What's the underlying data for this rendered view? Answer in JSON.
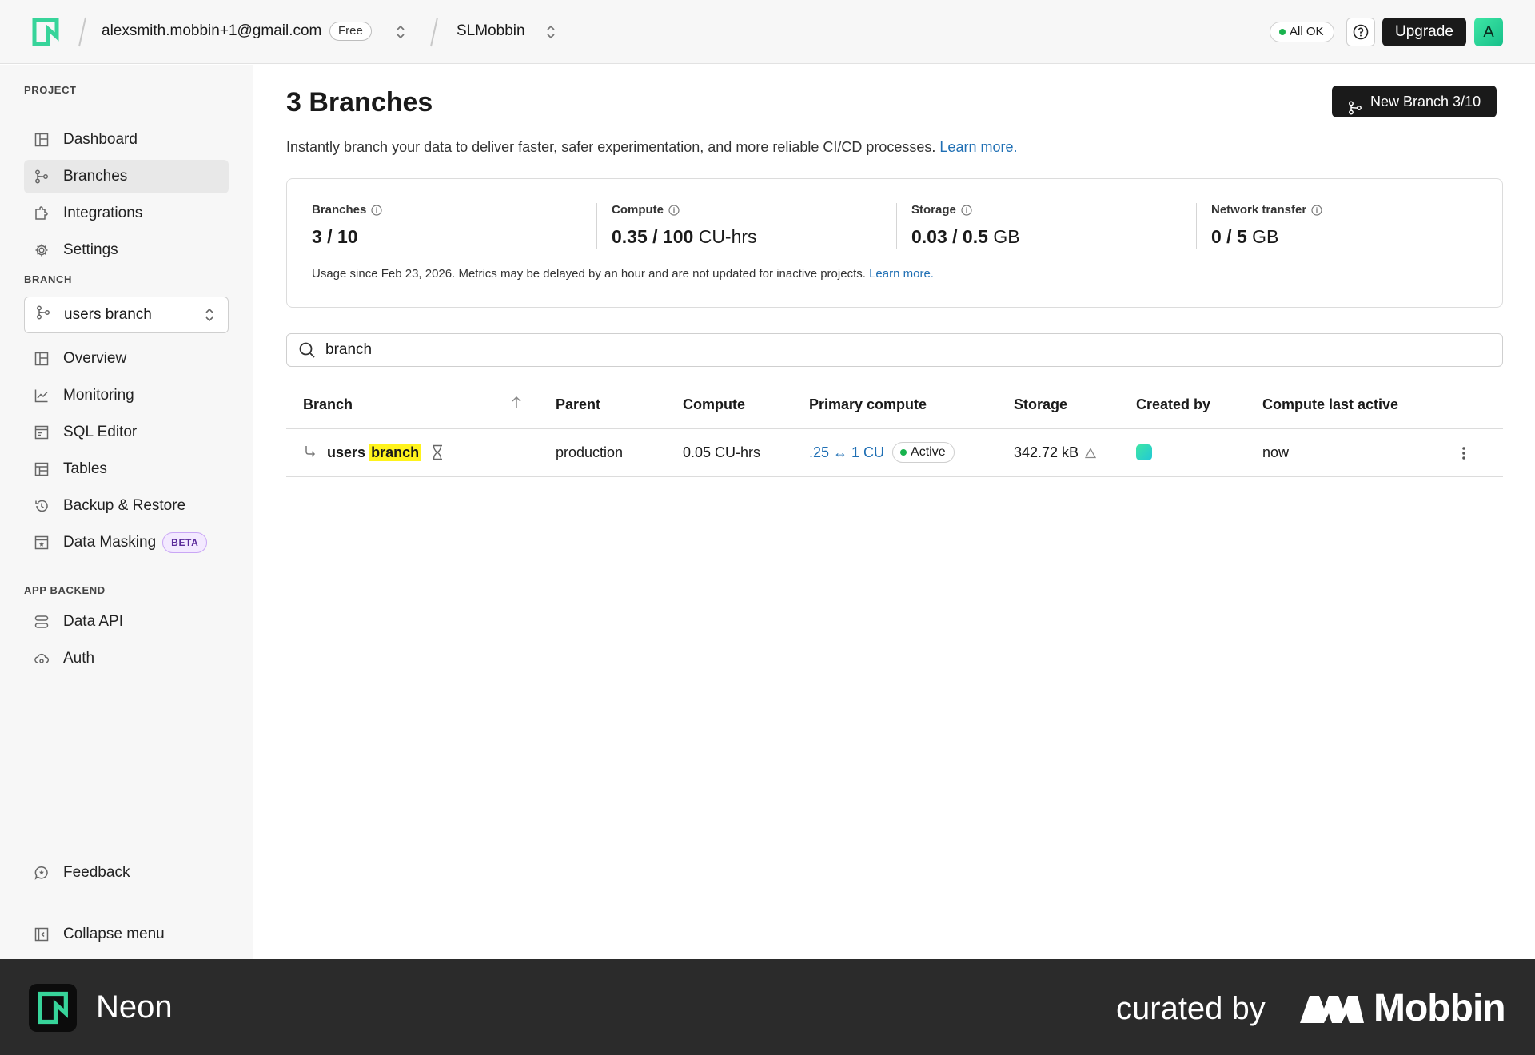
{
  "topbar": {
    "account_email": "alexsmith.mobbin+1@gmail.com",
    "plan_badge": "Free",
    "project_name": "SLMobbin",
    "status_label": "All OK",
    "upgrade_label": "Upgrade",
    "avatar_initial": "A"
  },
  "sidebar": {
    "project_label": "PROJECT",
    "project_items": [
      {
        "label": "Dashboard",
        "icon": "dashboard-icon"
      },
      {
        "label": "Branches",
        "icon": "branch-icon"
      },
      {
        "label": "Integrations",
        "icon": "puzzle-icon"
      },
      {
        "label": "Settings",
        "icon": "gear-icon"
      }
    ],
    "branch_label": "BRANCH",
    "branch_selector": "users branch",
    "branch_items": [
      {
        "label": "Overview",
        "icon": "overview-icon"
      },
      {
        "label": "Monitoring",
        "icon": "chart-line-icon"
      },
      {
        "label": "SQL Editor",
        "icon": "sql-editor-icon"
      },
      {
        "label": "Tables",
        "icon": "table-icon"
      },
      {
        "label": "Backup & Restore",
        "icon": "history-icon"
      },
      {
        "label": "Data Masking",
        "icon": "mask-icon",
        "badge": "BETA"
      }
    ],
    "backend_label": "APP BACKEND",
    "backend_items": [
      {
        "label": "Data API",
        "icon": "api-icon"
      },
      {
        "label": "Auth",
        "icon": "auth-cloud-icon"
      }
    ],
    "feedback_label": "Feedback",
    "collapse_label": "Collapse menu"
  },
  "main": {
    "title": "3 Branches",
    "new_branch_label": "New Branch 3/10",
    "subtitle": "Instantly branch your data to deliver faster, safer experimentation, and more reliable CI/CD processes.",
    "subtitle_link": "Learn more.",
    "usage": {
      "metrics": [
        {
          "label": "Branches",
          "value": "3 / 10",
          "unit": ""
        },
        {
          "label": "Compute",
          "value": "0.35 / 100",
          "unit": "CU-hrs"
        },
        {
          "label": "Storage",
          "value": "0.03 / 0.5",
          "unit": "GB"
        },
        {
          "label": "Network transfer",
          "value": "0 / 5",
          "unit": "GB"
        }
      ],
      "note": "Usage since Feb 23, 2026. Metrics may be delayed by an hour and are not updated for inactive projects.",
      "note_link": "Learn more."
    },
    "search_value": "branch",
    "table": {
      "columns": [
        "Branch",
        "Parent",
        "Compute",
        "Primary compute",
        "Storage",
        "Created by",
        "Compute last active"
      ],
      "rows": [
        {
          "branch_prefix": "users",
          "branch_match": "branch",
          "parent": "production",
          "compute": "0.05 CU-hrs",
          "primary_compute_range": ".25 ↔ 1 CU",
          "primary_compute_status": "Active",
          "storage": "342.72 kB",
          "last_active": "now"
        }
      ]
    }
  },
  "footer": {
    "app_name": "Neon",
    "curated_by": "curated by",
    "brand": "Mobbin"
  },
  "colors": {
    "accent_green": "#18b34e",
    "link_blue": "#1f6fb4",
    "neon_brand": "#3ee6a5",
    "highlight_yellow": "#fff31c",
    "beta_purple": "#f3e9ff"
  }
}
